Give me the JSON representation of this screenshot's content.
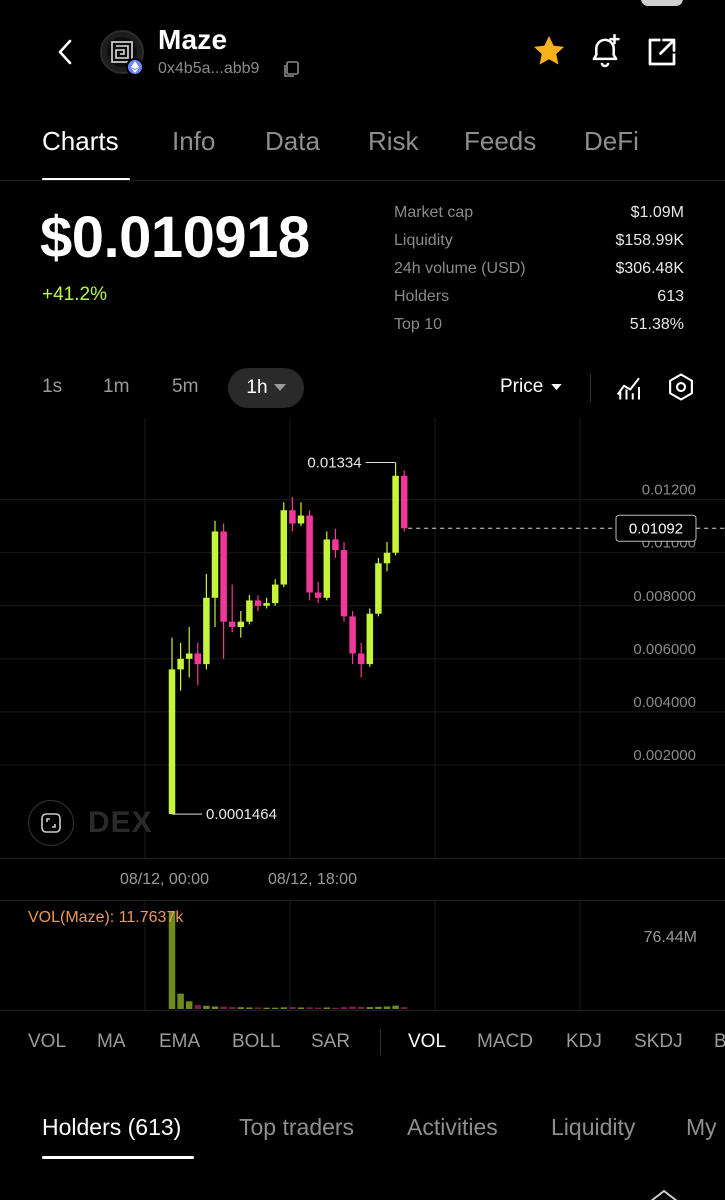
{
  "header": {
    "token_name": "Maze",
    "token_address": "0x4b5a...abb9"
  },
  "tabs": [
    "Charts",
    "Info",
    "Data",
    "Risk",
    "Feeds",
    "DeFi"
  ],
  "price": {
    "value": "$0.010918",
    "change": "+41.2%"
  },
  "stats": [
    {
      "label": "Market cap",
      "value": "$1.09M"
    },
    {
      "label": "Liquidity",
      "value": "$158.99K"
    },
    {
      "label": "24h volume (USD)",
      "value": "$306.48K"
    },
    {
      "label": "Holders",
      "value": "613"
    },
    {
      "label": "Top 10",
      "value": "51.38%"
    }
  ],
  "toolbar": {
    "timeframes": [
      "1s",
      "1m",
      "5m"
    ],
    "active_timeframe": "1h",
    "price_mode": "Price"
  },
  "watermark": "DEX",
  "chart_data": {
    "type": "candlestick",
    "y_axis_ticks": [
      "0.01200",
      "0.01000",
      "0.008000",
      "0.006000",
      "0.004000",
      "0.002000"
    ],
    "ylim": [
      0,
      0.0147
    ],
    "current_price_label": "0.01092",
    "current_price": 0.01092,
    "high_annotation": "0.01334",
    "low_annotation": "0.0001464",
    "x_tick_labels": [
      "08/12, 00:00",
      "08/12, 18:00"
    ],
    "candles": [
      {
        "o": 0.00015,
        "h": 0.0068,
        "l": 0.000146,
        "c": 0.0056
      },
      {
        "o": 0.0056,
        "h": 0.0066,
        "l": 0.0048,
        "c": 0.006
      },
      {
        "o": 0.006,
        "h": 0.0072,
        "l": 0.0053,
        "c": 0.0062
      },
      {
        "o": 0.0062,
        "h": 0.0066,
        "l": 0.005,
        "c": 0.0058
      },
      {
        "o": 0.0058,
        "h": 0.0092,
        "l": 0.0056,
        "c": 0.0083
      },
      {
        "o": 0.0083,
        "h": 0.0112,
        "l": 0.0072,
        "c": 0.0108
      },
      {
        "o": 0.0108,
        "h": 0.0111,
        "l": 0.006,
        "c": 0.0074
      },
      {
        "o": 0.0074,
        "h": 0.0088,
        "l": 0.007,
        "c": 0.0072
      },
      {
        "o": 0.0072,
        "h": 0.0078,
        "l": 0.0068,
        "c": 0.0074
      },
      {
        "o": 0.0074,
        "h": 0.0084,
        "l": 0.0073,
        "c": 0.0082
      },
      {
        "o": 0.0082,
        "h": 0.0084,
        "l": 0.0078,
        "c": 0.008
      },
      {
        "o": 0.008,
        "h": 0.0083,
        "l": 0.0079,
        "c": 0.0081
      },
      {
        "o": 0.0081,
        "h": 0.009,
        "l": 0.008,
        "c": 0.0088
      },
      {
        "o": 0.0088,
        "h": 0.0119,
        "l": 0.0087,
        "c": 0.0116
      },
      {
        "o": 0.0116,
        "h": 0.0121,
        "l": 0.0108,
        "c": 0.0111
      },
      {
        "o": 0.0111,
        "h": 0.0119,
        "l": 0.011,
        "c": 0.0114
      },
      {
        "o": 0.0114,
        "h": 0.0116,
        "l": 0.0082,
        "c": 0.0085
      },
      {
        "o": 0.0085,
        "h": 0.0089,
        "l": 0.0081,
        "c": 0.0083
      },
      {
        "o": 0.0083,
        "h": 0.0108,
        "l": 0.0082,
        "c": 0.0105
      },
      {
        "o": 0.0105,
        "h": 0.0109,
        "l": 0.0098,
        "c": 0.0101
      },
      {
        "o": 0.0101,
        "h": 0.0104,
        "l": 0.0074,
        "c": 0.0076
      },
      {
        "o": 0.0076,
        "h": 0.0078,
        "l": 0.0058,
        "c": 0.0062
      },
      {
        "o": 0.0062,
        "h": 0.0066,
        "l": 0.0053,
        "c": 0.0058
      },
      {
        "o": 0.0058,
        "h": 0.0079,
        "l": 0.0057,
        "c": 0.0077
      },
      {
        "o": 0.0077,
        "h": 0.0098,
        "l": 0.0076,
        "c": 0.0096
      },
      {
        "o": 0.0096,
        "h": 0.0104,
        "l": 0.0093,
        "c": 0.01
      },
      {
        "o": 0.01,
        "h": 0.0134,
        "l": 0.0099,
        "c": 0.0129
      },
      {
        "o": 0.0129,
        "h": 0.0131,
        "l": 0.0108,
        "c": 0.01092
      }
    ]
  },
  "volume": {
    "label": "VOL(Maze): 11.7637k",
    "max_label": "76.44M",
    "values": [
      76.44,
      12,
      6,
      3,
      2.5,
      2,
      1.8,
      1.5,
      1.4,
      1.2,
      1.2,
      1.0,
      1.0,
      1.3,
      1.5,
      1.2,
      1.3,
      1.1,
      1.2,
      1.0,
      1.4,
      1.8,
      1.6,
      1.5,
      1.7,
      2.0,
      2.6,
      1.4
    ]
  },
  "indicators": {
    "overlay": [
      "VOL",
      "MA",
      "EMA",
      "BOLL",
      "SAR"
    ],
    "sub": [
      "VOL",
      "MACD",
      "KDJ",
      "SKDJ",
      "B"
    ],
    "active_sub": "VOL"
  },
  "bottom_tabs": [
    "Holders (613)",
    "Top traders",
    "Activities",
    "Liquidity",
    "My"
  ],
  "colors": {
    "up": "#c6f43a",
    "down": "#f2379b",
    "accent_change": "#b8f84a",
    "star": "#f7b21b",
    "volume_label": "#e89a5a"
  }
}
